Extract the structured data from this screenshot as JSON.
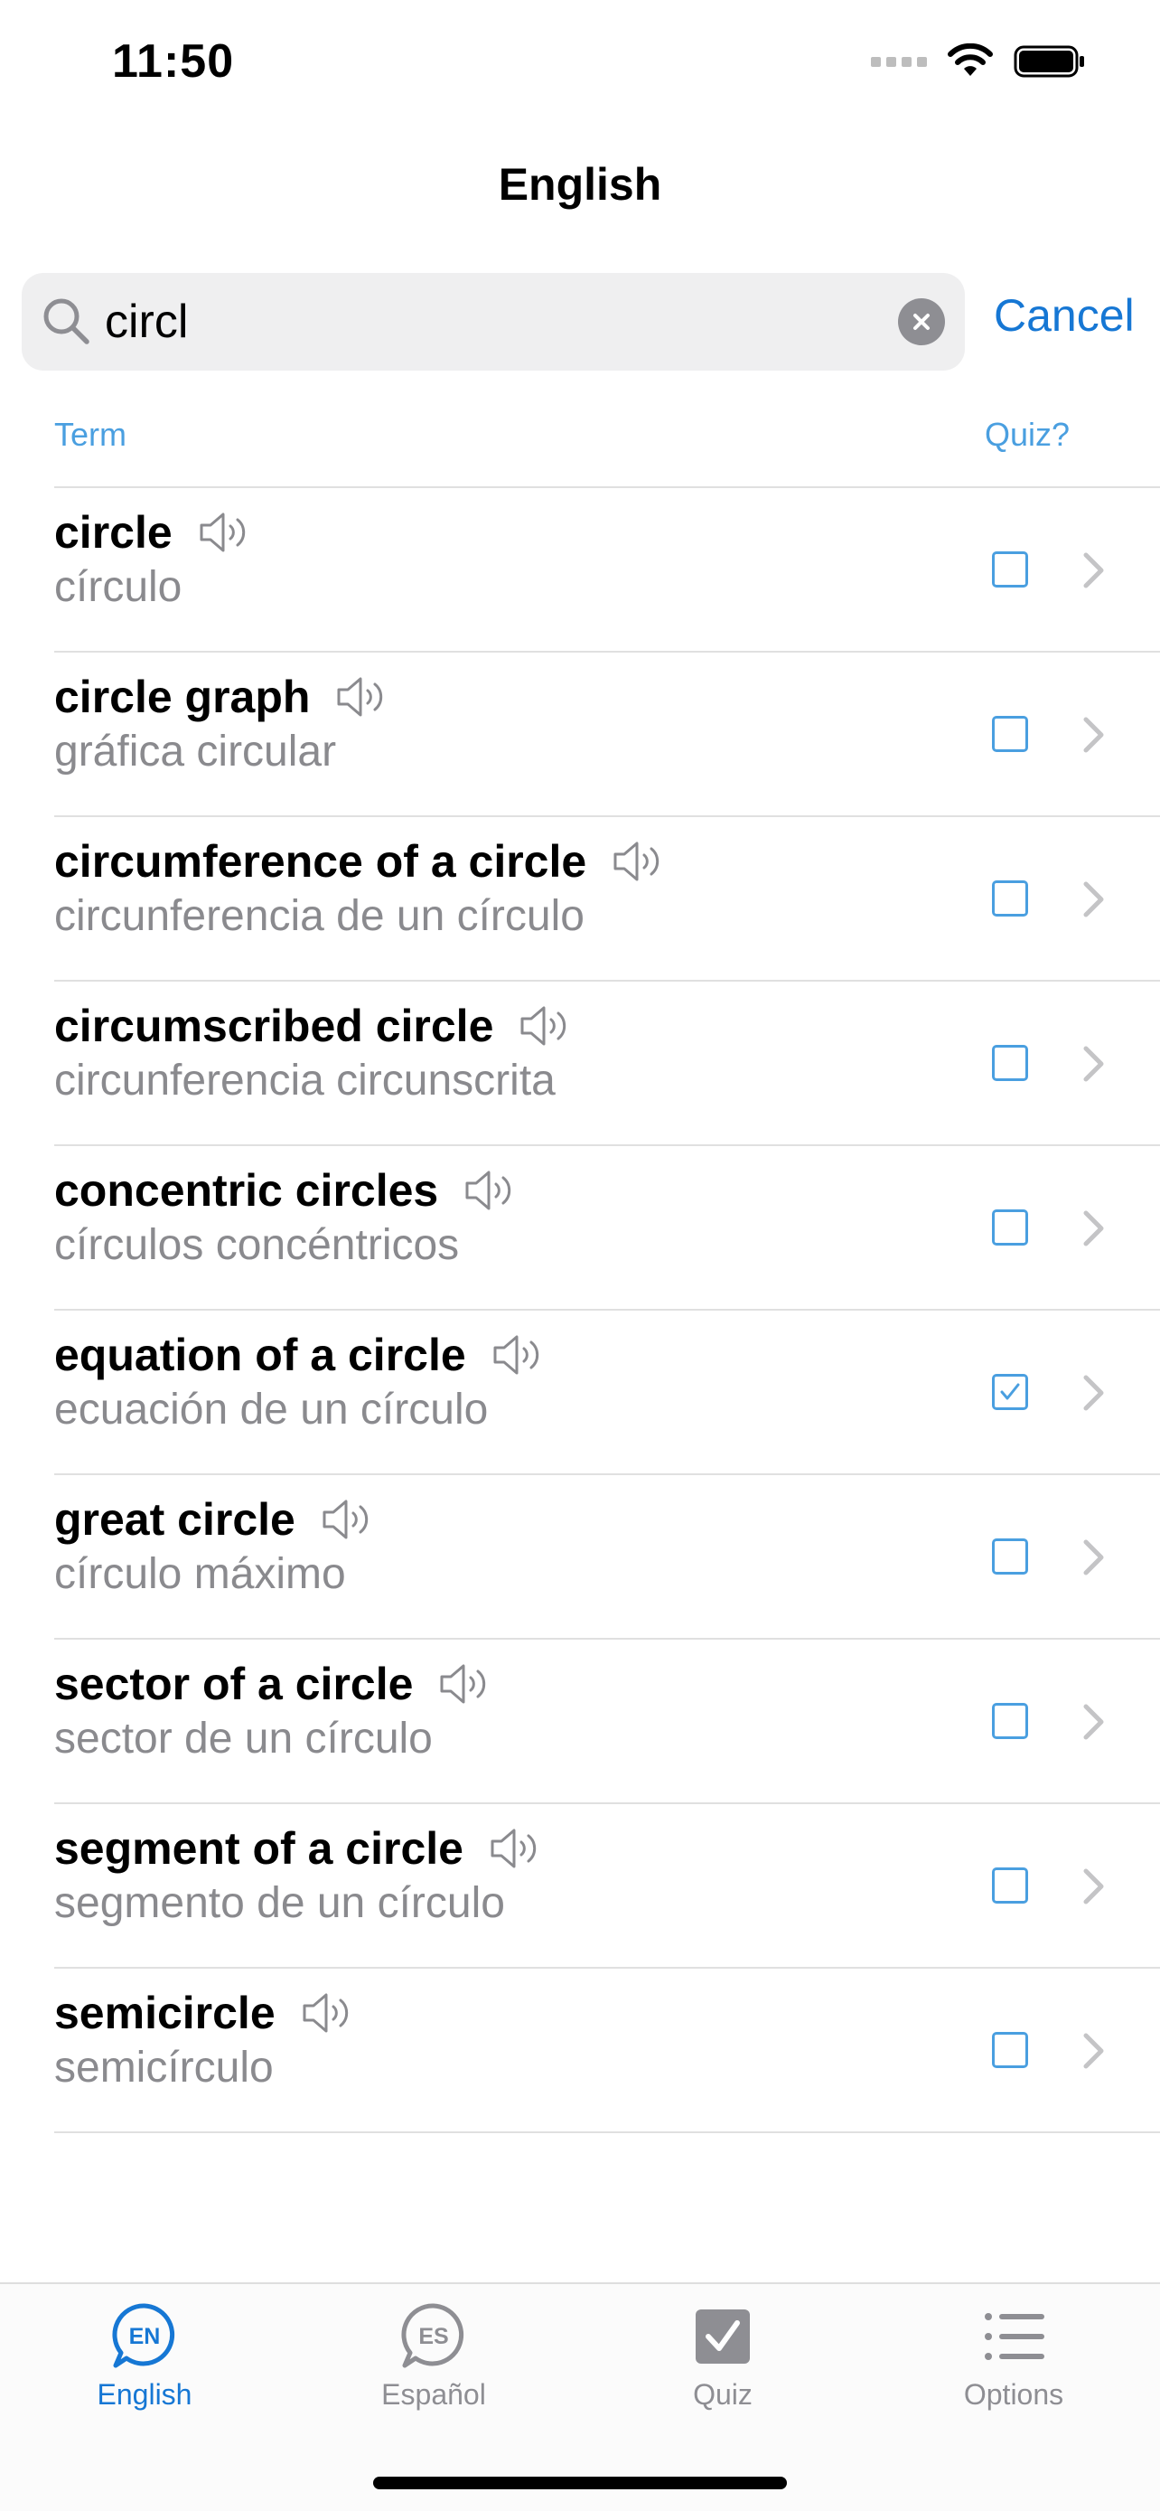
{
  "status": {
    "time": "11:50"
  },
  "nav": {
    "title": "English"
  },
  "search": {
    "value": "circl",
    "cancel_label": "Cancel"
  },
  "list_header": {
    "term": "Term",
    "quiz": "Quiz?"
  },
  "terms": [
    {
      "en": "circle",
      "es": "círculo",
      "quiz": false
    },
    {
      "en": "circle graph",
      "es": "gráfica circular",
      "quiz": false
    },
    {
      "en": "circumference of a circle",
      "es": "circunferencia de un círculo",
      "quiz": false
    },
    {
      "en": "circumscribed circle",
      "es": "circunferencia circunscrita",
      "quiz": false
    },
    {
      "en": "concentric circles",
      "es": "círculos concéntricos",
      "quiz": false
    },
    {
      "en": "equation of a circle",
      "es": "ecuación de un círculo",
      "quiz": true
    },
    {
      "en": "great circle",
      "es": "círculo máximo",
      "quiz": false
    },
    {
      "en": "sector of a circle",
      "es": "sector de un círculo",
      "quiz": false
    },
    {
      "en": "segment of a circle",
      "es": "segmento de un círculo",
      "quiz": false
    },
    {
      "en": "semicircle",
      "es": "semicírculo",
      "quiz": false
    }
  ],
  "tabs": [
    {
      "label": "English",
      "icon": "en-bubble-icon",
      "badge": "EN",
      "active": true
    },
    {
      "label": "Español",
      "icon": "es-bubble-icon",
      "badge": "ES",
      "active": false
    },
    {
      "label": "Quiz",
      "icon": "quiz-check-icon",
      "active": false
    },
    {
      "label": "Options",
      "icon": "list-icon",
      "active": false
    }
  ],
  "colors": {
    "accent": "#1677d4",
    "light_accent": "#4a9fe0",
    "secondary_text": "#8a8a8e"
  }
}
